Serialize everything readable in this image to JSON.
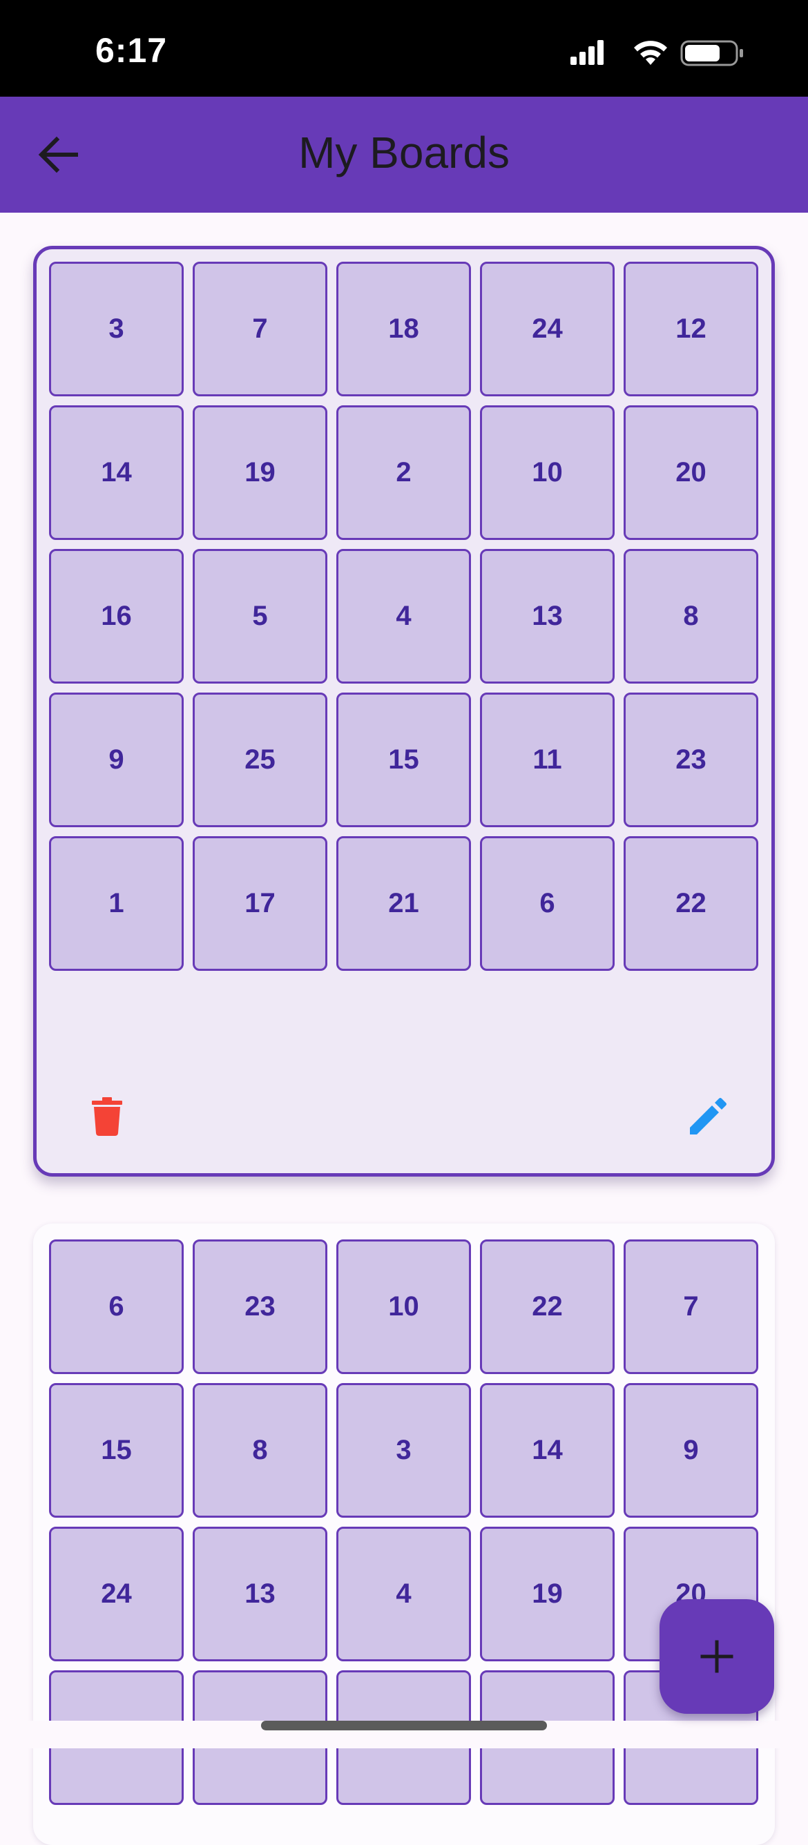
{
  "status_bar": {
    "time": "6:17",
    "icons": [
      "signal-icon",
      "wifi-icon",
      "battery-icon"
    ]
  },
  "app_bar": {
    "title": "My Boards",
    "back_icon": "arrow-back-icon",
    "background_color": "#673ab7"
  },
  "boards": [
    {
      "cells": [
        "3",
        "7",
        "18",
        "24",
        "12",
        "14",
        "19",
        "2",
        "10",
        "20",
        "16",
        "5",
        "4",
        "13",
        "8",
        "9",
        "25",
        "15",
        "11",
        "23",
        "1",
        "17",
        "21",
        "6",
        "22"
      ],
      "selected": true,
      "delete_icon": "trash-icon",
      "edit_icon": "pencil-icon"
    },
    {
      "cells": [
        "6",
        "23",
        "10",
        "22",
        "7",
        "15",
        "8",
        "3",
        "14",
        "9",
        "24",
        "13",
        "4",
        "19",
        "20",
        "",
        "",
        "",
        "",
        ""
      ],
      "selected": false
    }
  ],
  "fab": {
    "icon": "plus-icon"
  },
  "colors": {
    "accent": "#673ab7",
    "cell_fill": "#d0c4e8",
    "cell_text": "#40269a",
    "delete": "#f44336",
    "edit": "#2196f3"
  }
}
